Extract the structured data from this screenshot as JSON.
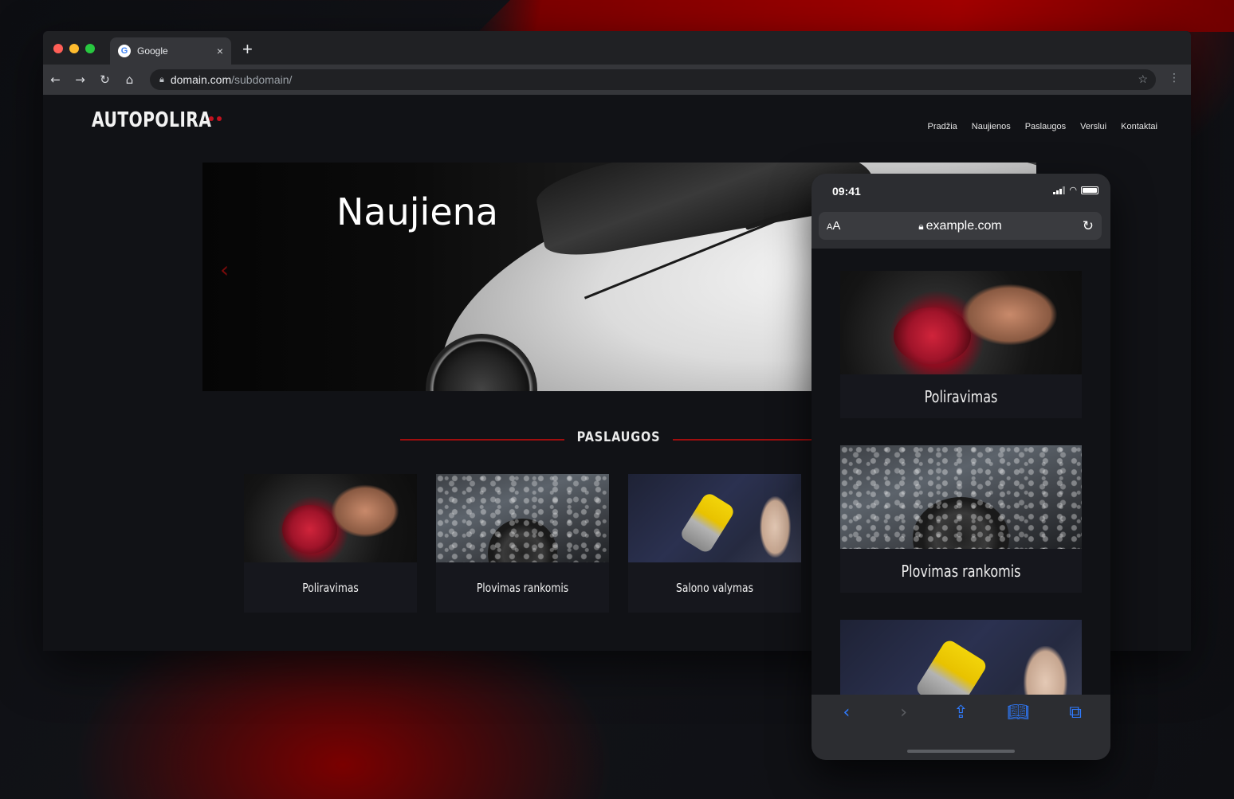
{
  "browser": {
    "tab_title": "Google",
    "tab_close": "×",
    "new_tab": "+",
    "url_host": "domain.com",
    "url_path": "/subdomain/"
  },
  "site": {
    "logo": "AUTOPOLIRA",
    "nav": [
      "Pradžia",
      "Naujienos",
      "Paslaugos",
      "Verslui",
      "Kontaktai"
    ],
    "hero_title": "Naujiena",
    "section_title": "PASLAUGOS",
    "services": [
      {
        "label": "Poliravimas",
        "image": "polishing-photo"
      },
      {
        "label": "Plovimas rankomis",
        "image": "hand-wash-photo"
      },
      {
        "label": "Salono valymas",
        "image": "interior-cleaning-photo"
      }
    ]
  },
  "phone": {
    "time": "09:41",
    "aa_label": "AA",
    "url": "example.com",
    "cards": [
      {
        "label": "Poliravimas"
      },
      {
        "label": "Plovimas rankomis"
      }
    ]
  },
  "colors": {
    "accent": "#c1121f",
    "ios_blue": "#2f7bff",
    "background": "#111216"
  }
}
